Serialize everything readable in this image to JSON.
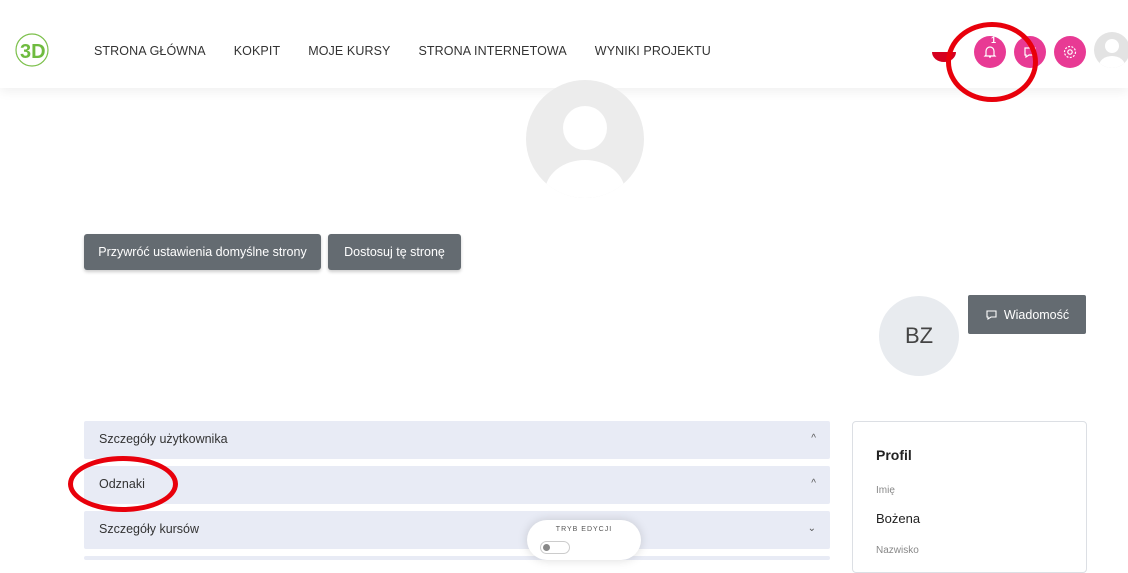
{
  "nav": {
    "logo_text": "3D",
    "items": [
      "STRONA GŁÓWNA",
      "KOKPIT",
      "MOJE KURSY",
      "STRONA INTERNETOWA",
      "WYNIKI PROJEKTU"
    ]
  },
  "header_icons": {
    "notification_count": "1",
    "icons": [
      "flag-icon",
      "bell-icon",
      "chat-icon",
      "gear-icon",
      "user-avatar"
    ]
  },
  "page_buttons": {
    "reset_label": "Przywróć ustawienia domyślne strony",
    "customize_label": "Dostosuj tę stronę"
  },
  "user": {
    "initials": "BZ",
    "message_label": "Wiadomość"
  },
  "sections": [
    {
      "label": "Szczegóły użytkownika",
      "chevron": "^"
    },
    {
      "label": "Odznaki",
      "chevron": "^"
    },
    {
      "label": "Szczegóły kursów",
      "chevron": "⌄"
    }
  ],
  "profile_card": {
    "title": "Profil",
    "first_name_label": "Imię",
    "first_name_value": "Bożena",
    "last_name_label": "Nazwisko"
  },
  "edit_mode": {
    "label": "TRYB EDYCJI"
  },
  "colors": {
    "accent_pink": "#e83a94",
    "button_gray": "#646b71",
    "annotation_red": "#e8000b",
    "accordion_bg": "#e8ebf5"
  }
}
